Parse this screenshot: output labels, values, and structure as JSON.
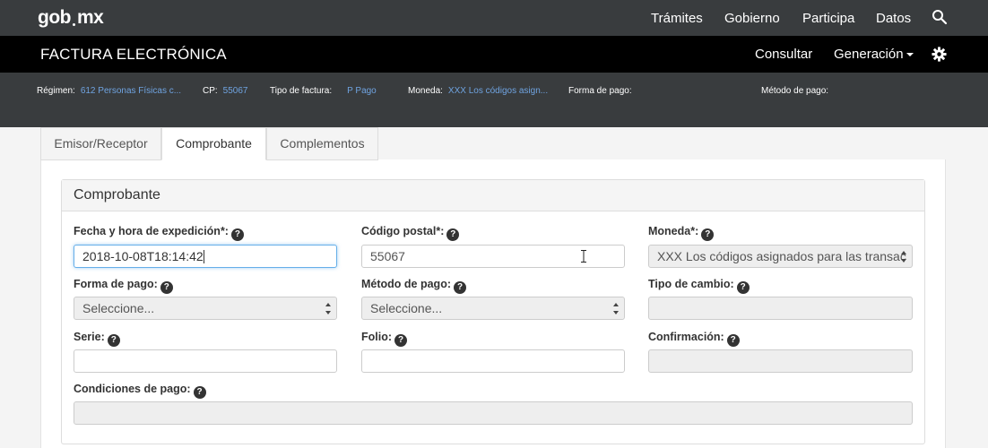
{
  "topbar": {
    "logo": {
      "left": "gob",
      "right": "mx"
    },
    "nav": [
      "Trámites",
      "Gobierno",
      "Participa",
      "Datos"
    ]
  },
  "appbar": {
    "title": "FACTURA ELECTRÓNICA",
    "consultar": "Consultar",
    "generacion": "Generación"
  },
  "infobar": {
    "regimen_label": "Régimen:",
    "regimen_value": "612 Personas Físicas c...",
    "cp_label": "CP:",
    "cp_value": "55067",
    "tipo_label": "Tipo de factura:",
    "tipo_value": "P Pago",
    "moneda_label": "Moneda:",
    "moneda_value": "XXX Los códigos asign...",
    "forma_label": "Forma de pago:",
    "metodo_label": "Método de pago:"
  },
  "tabs": [
    "Emisor/Receptor",
    "Comprobante",
    "Complementos"
  ],
  "card": {
    "title": "Comprobante",
    "fields": {
      "fecha": {
        "label": "Fecha y hora de expedición*:",
        "value": "2018-10-08T18:14:42"
      },
      "cp": {
        "label": "Código postal*:",
        "value": "55067"
      },
      "moneda": {
        "label": "Moneda*:",
        "value": "XXX Los códigos asignados para las transac"
      },
      "forma": {
        "label": "Forma de pago:",
        "value": "Seleccione..."
      },
      "metodo": {
        "label": "Método de pago:",
        "value": "Seleccione..."
      },
      "tipo_cambio": {
        "label": "Tipo de cambio:",
        "value": ""
      },
      "serie": {
        "label": "Serie:",
        "value": ""
      },
      "folio": {
        "label": "Folio:",
        "value": ""
      },
      "confirmacion": {
        "label": "Confirmación:",
        "value": ""
      },
      "condiciones": {
        "label": "Condiciones de pago:",
        "value": ""
      }
    },
    "help_glyph": "?"
  }
}
